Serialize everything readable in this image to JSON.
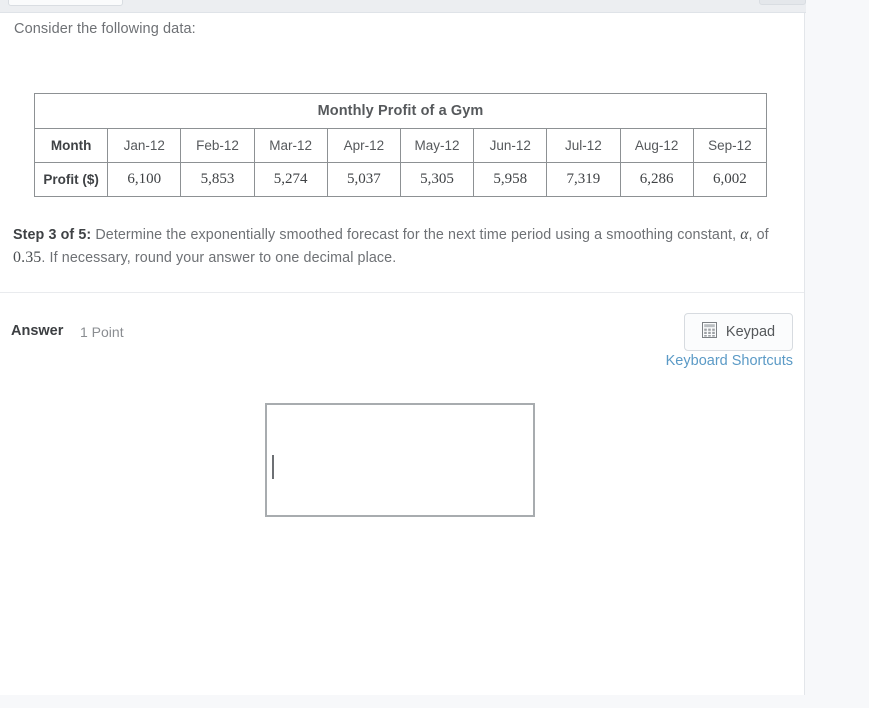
{
  "page": {
    "intro_text": "Consider the following data:"
  },
  "table": {
    "title": "Monthly Profit of a Gym",
    "row_headers": [
      "Month",
      "Profit ($)"
    ],
    "months": [
      "Jan-12",
      "Feb-12",
      "Mar-12",
      "Apr-12",
      "May-12",
      "Jun-12",
      "Jul-12",
      "Aug-12",
      "Sep-12"
    ],
    "profits": [
      "6,100",
      "5,853",
      "5,274",
      "5,037",
      "5,305",
      "5,958",
      "7,319",
      "6,286",
      "6,002"
    ]
  },
  "step": {
    "label": "Step 3 of 5:",
    "text_part1": " Determine the exponentially smoothed forecast for the next time period using a smoothing constant, ",
    "alpha_symbol": "α",
    "text_part2": ", of ",
    "alpha_value": "0.35",
    "text_part3": ". If necessary, round your answer to one decimal place."
  },
  "answer": {
    "label": "Answer",
    "points": "1 Point",
    "keypad_label": "Keypad",
    "keypad_icon": "calculator-icon",
    "keyboard_shortcuts_label": "Keyboard Shortcuts",
    "input_value": ""
  },
  "colors": {
    "link": "#5b9ac6",
    "panel_background": "#ffffff",
    "page_background": "#f7f8fa",
    "table_border": "#8d9194",
    "input_border": "#a8acaf"
  }
}
